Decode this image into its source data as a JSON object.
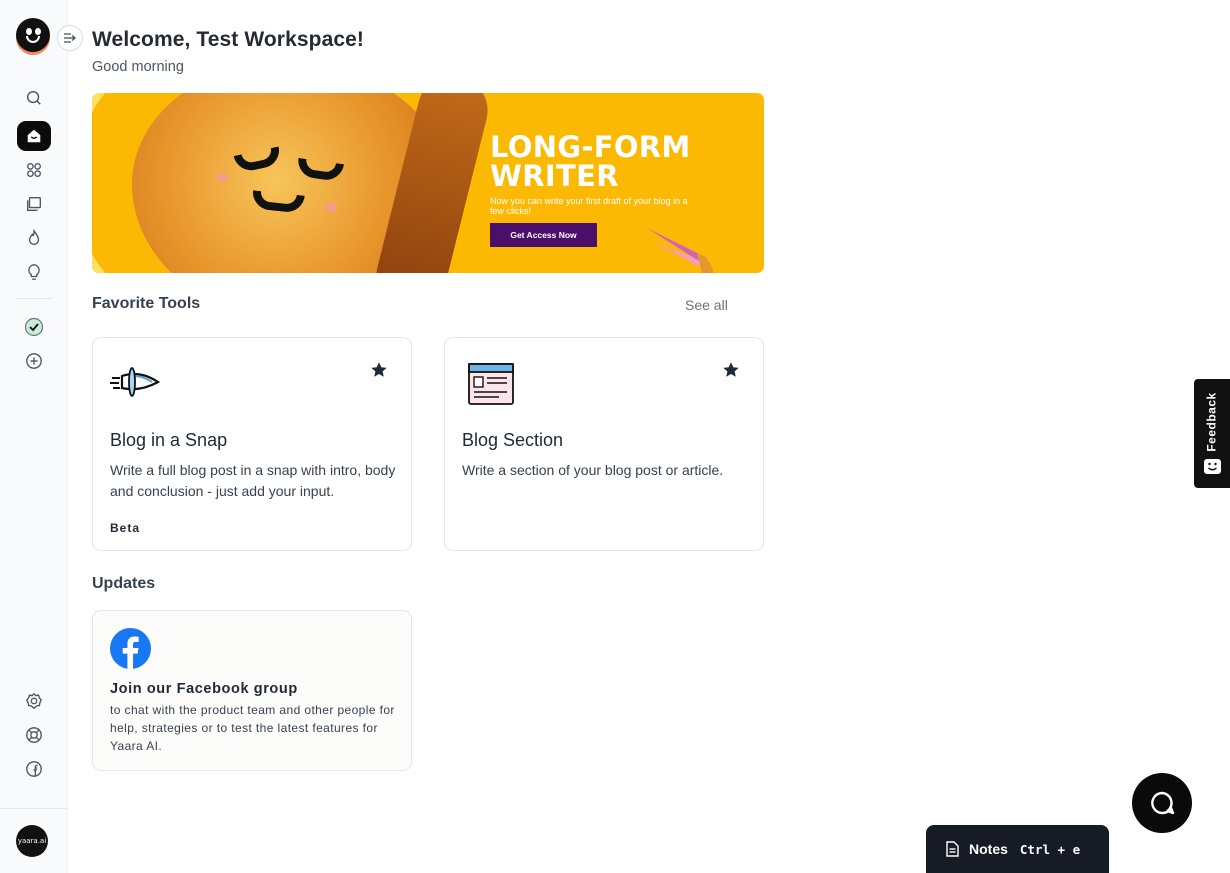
{
  "header": {
    "welcome": "Welcome, Test Workspace!",
    "greeting": "Good morning"
  },
  "banner": {
    "title_line1": "LONG-FORM",
    "title_line2": "WRITER",
    "subtitle": "Now you can write your first draft of your blog in a few clicks!",
    "cta": "Get Access Now"
  },
  "favorites": {
    "title": "Favorite Tools",
    "see_all": "See all",
    "tools": [
      {
        "name": "Blog in a Snap",
        "description": "Write a full blog post in a snap with intro, body and conclusion - just add your input.",
        "tag": "Beta",
        "icon": "paper-plane-icon",
        "starred": true
      },
      {
        "name": "Blog Section",
        "description": "Write a section of your blog post or article.",
        "tag": "",
        "icon": "web-page-icon",
        "starred": true
      }
    ]
  },
  "updates": {
    "title": "Updates",
    "items": [
      {
        "heading": "Join our Facebook group",
        "body": "to chat with the product team and other people for help, strategies or to test the latest features for Yaara AI.",
        "icon": "facebook-icon"
      }
    ]
  },
  "sidebar": {
    "items": [
      {
        "icon": "search-icon",
        "active": false
      },
      {
        "icon": "home-icon",
        "active": true
      },
      {
        "icon": "apps-grid-icon",
        "active": false
      },
      {
        "icon": "documents-icon",
        "active": false
      },
      {
        "icon": "flame-icon",
        "active": false
      },
      {
        "icon": "lightbulb-icon",
        "active": false
      },
      {
        "icon": "check-circle-icon",
        "active": false
      },
      {
        "icon": "add-circle-icon",
        "active": false
      },
      {
        "icon": "settings-icon",
        "active": false
      },
      {
        "icon": "support-lifebuoy-icon",
        "active": false
      },
      {
        "icon": "facebook-icon",
        "active": false
      }
    ],
    "avatar_text": "yaara.ai"
  },
  "feedback": {
    "label": "Feedback"
  },
  "notes": {
    "label": "Notes",
    "shortcut": "Ctrl + e"
  },
  "colors": {
    "accent_dark": "#0b0b0b",
    "banner_yellow": "#fbb903",
    "cta_purple": "#4a0e6b",
    "facebook_blue": "#1877f2"
  }
}
